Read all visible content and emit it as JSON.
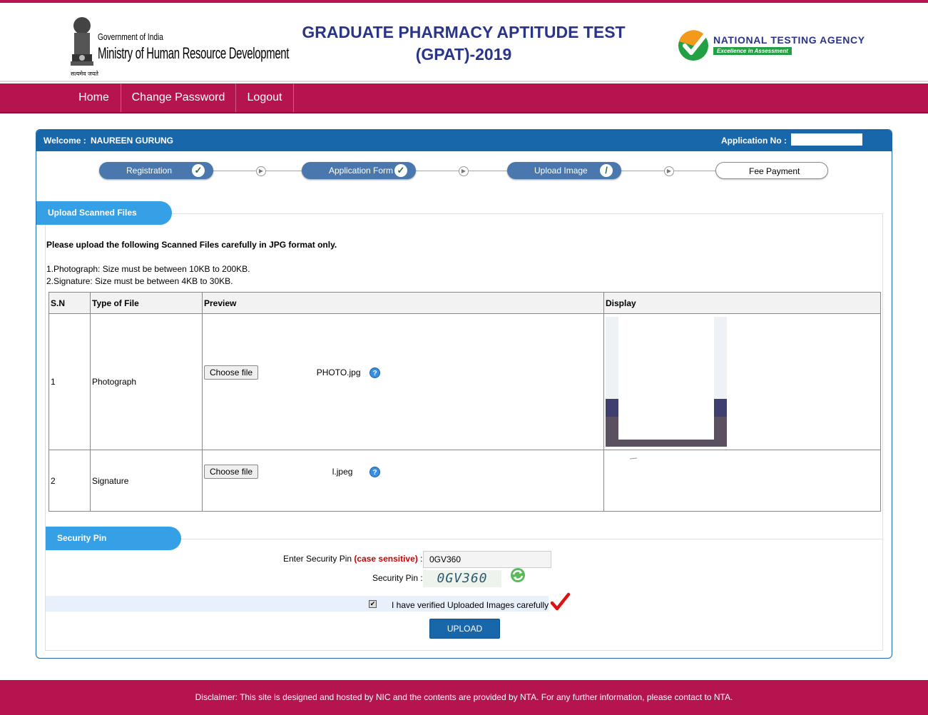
{
  "header": {
    "moe_small": "Government of India",
    "moe_big": "Ministry of Human Resource Development",
    "moe_hindi": "सत्यमेव जयते",
    "title_line1": "GRADUATE PHARMACY APTITUDE TEST",
    "title_line2": "(GPAT)-2019",
    "nta_name": "NATIONAL TESTING AGENCY",
    "nta_tagline": "Excellence in Assessment"
  },
  "nav": {
    "home": "Home",
    "change_password": "Change Password",
    "logout": "Logout"
  },
  "welcome": {
    "label": "Welcome :",
    "name": "NAUREEN GURUNG",
    "appno_label": "Application No :"
  },
  "steps": {
    "registration": "Registration",
    "application_form": "Application Form",
    "upload_image": "Upload Image",
    "fee_payment": "Fee Payment"
  },
  "upload_section": {
    "tab_label": "Upload Scanned Files",
    "instruction": "Please upload the following Scanned Files carefully in JPG format only.",
    "rule1": "1.Photograph: Size must be between 10KB to 200KB.",
    "rule2": "2.Signature: Size must be between 4KB to 30KB.",
    "columns": {
      "sn": "S.N",
      "type": "Type of File",
      "preview": "Preview",
      "display": "Display"
    },
    "rows": [
      {
        "sn": "1",
        "type": "Photograph",
        "button": "Choose file",
        "filename": "PHOTO.jpg"
      },
      {
        "sn": "2",
        "type": "Signature",
        "button": "Choose file",
        "filename": "l.jpeg"
      }
    ]
  },
  "security": {
    "tab_label": "Security Pin",
    "enter_label": "Enter Security Pin",
    "case_note": "(case sensitive)",
    "colon": ":",
    "input_value": "0GV360",
    "pin_label": "Security Pin :",
    "captcha_text": "0GV360",
    "verify_label": "I have verified Uploaded Images carefully",
    "upload_button": "UPLOAD"
  },
  "footer": {
    "disclaimer": "Disclaimer: This site is designed and hosted by NIC and the contents are provided by NTA. For any further information, please contact to NTA."
  },
  "colors": {
    "brand_maroon": "#b5144f",
    "brand_blue": "#1867ab",
    "tab_blue": "#35a0e6",
    "title_navy": "#2a3489"
  }
}
